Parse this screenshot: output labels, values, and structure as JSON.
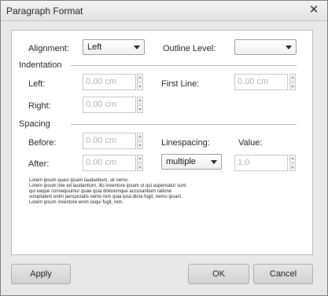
{
  "window": {
    "title": "Paragraph Format",
    "close_icon": "close-icon"
  },
  "alignment": {
    "label": "Alignment:",
    "value": "Left"
  },
  "outline_level": {
    "label": "Outline Level:",
    "value": ""
  },
  "indentation": {
    "heading": "Indentation",
    "left": {
      "label": "Left:",
      "placeholder": "0.00 cm"
    },
    "right": {
      "label": "Right:",
      "placeholder": "0.00 cm"
    },
    "first_line": {
      "label": "First Line:",
      "placeholder": "0.00 cm"
    }
  },
  "spacing": {
    "heading": "Spacing",
    "before": {
      "label": "Before:",
      "placeholder": "0.00 cm"
    },
    "after": {
      "label": "After:",
      "placeholder": "0.00 cm"
    },
    "linespacing": {
      "label": "Linespacing:",
      "value": "multiple"
    },
    "value": {
      "label": "Value:",
      "placeholder": "1.0"
    }
  },
  "preview_lines": [
    "Lorem ipsum quasi ipsam laudantium, sit nemo.",
    "Lorem ipsum iste ed laudantium, illo inventore ipsam ut qui aspernatur sunt",
    "qui eaque consequuntur quae quia doloremque accusantium ratione",
    "voluptatem enim perspiciatis nemo rem quia ipsa dicta fugit, nemo ipsam.",
    "Lorem ipsum inventore enim sequi fugit, rem."
  ],
  "buttons": {
    "apply": "Apply",
    "ok": "OK",
    "cancel": "Cancel"
  }
}
